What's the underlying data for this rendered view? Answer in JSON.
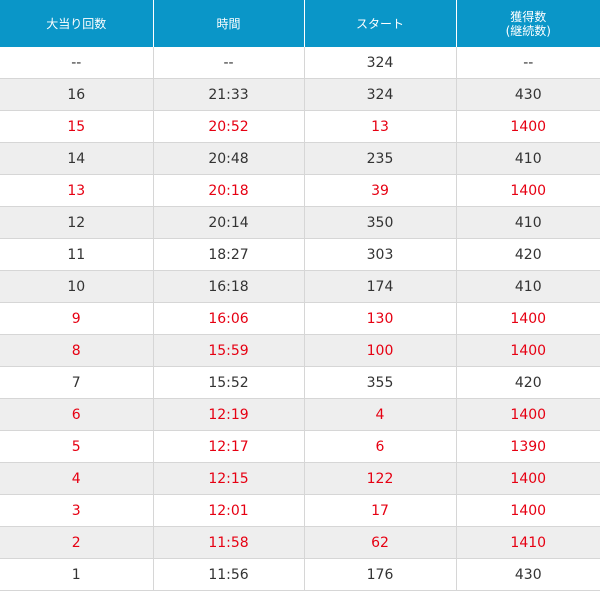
{
  "table": {
    "headers": [
      "大当り回数",
      "時間",
      "スタート",
      "獲得数\n(継続数)"
    ],
    "header_bg": "#0a96c8",
    "highlight_color": "#e60012",
    "rows": [
      {
        "count": "--",
        "time": "--",
        "start": "324",
        "gain": "--",
        "hit": false
      },
      {
        "count": "16",
        "time": "21:33",
        "start": "324",
        "gain": "430",
        "hit": false
      },
      {
        "count": "15",
        "time": "20:52",
        "start": "13",
        "gain": "1400",
        "hit": true
      },
      {
        "count": "14",
        "time": "20:48",
        "start": "235",
        "gain": "410",
        "hit": false
      },
      {
        "count": "13",
        "time": "20:18",
        "start": "39",
        "gain": "1400",
        "hit": true
      },
      {
        "count": "12",
        "time": "20:14",
        "start": "350",
        "gain": "410",
        "hit": false
      },
      {
        "count": "11",
        "time": "18:27",
        "start": "303",
        "gain": "420",
        "hit": false
      },
      {
        "count": "10",
        "time": "16:18",
        "start": "174",
        "gain": "410",
        "hit": false
      },
      {
        "count": "9",
        "time": "16:06",
        "start": "130",
        "gain": "1400",
        "hit": true
      },
      {
        "count": "8",
        "time": "15:59",
        "start": "100",
        "gain": "1400",
        "hit": true
      },
      {
        "count": "7",
        "time": "15:52",
        "start": "355",
        "gain": "420",
        "hit": false
      },
      {
        "count": "6",
        "time": "12:19",
        "start": "4",
        "gain": "1400",
        "hit": true
      },
      {
        "count": "5",
        "time": "12:17",
        "start": "6",
        "gain": "1390",
        "hit": true
      },
      {
        "count": "4",
        "time": "12:15",
        "start": "122",
        "gain": "1400",
        "hit": true
      },
      {
        "count": "3",
        "time": "12:01",
        "start": "17",
        "gain": "1400",
        "hit": true
      },
      {
        "count": "2",
        "time": "11:58",
        "start": "62",
        "gain": "1410",
        "hit": true
      },
      {
        "count": "1",
        "time": "11:56",
        "start": "176",
        "gain": "430",
        "hit": false
      }
    ]
  }
}
